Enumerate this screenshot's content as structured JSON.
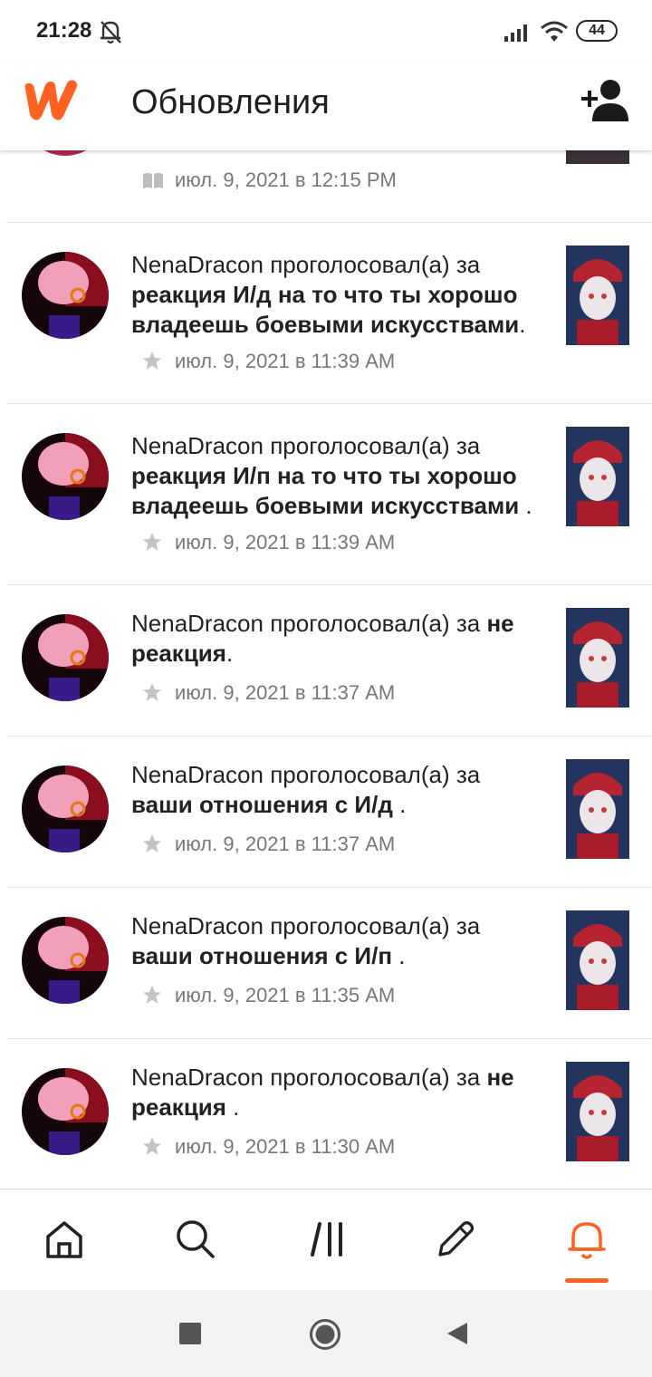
{
  "status_bar": {
    "time": "21:28",
    "battery": "44"
  },
  "header": {
    "title": "Обновления",
    "logo_icon": "wattpad-logo",
    "action_icon": "add-user-icon"
  },
  "partial_top_item": {
    "meta": "июл. 9, 2021 в 12:15 PM"
  },
  "notifications": [
    {
      "user": "NenaDracon",
      "action": " проголосовал(а) за ",
      "story": "реакция И/д на то что ты хорошо владеешь боевыми искусствами",
      "tail": ".",
      "meta": "июл. 9, 2021 в 11:39 AM"
    },
    {
      "user": "NenaDracon",
      "action": " проголосовал(а) за ",
      "story": "реакция И/п на то что ты хорошо владеешь боевыми искусствами",
      "tail": " .",
      "meta": "июл. 9, 2021 в 11:39 AM"
    },
    {
      "user": "NenaDracon",
      "action": " проголосовал(а) за ",
      "story": "не реакция",
      "tail": ".",
      "meta": "июл. 9, 2021 в 11:37 AM"
    },
    {
      "user": "NenaDracon",
      "action": " проголосовал(а) за ",
      "story": "ваши отношения с И/д",
      "tail": " .",
      "meta": "июл. 9, 2021 в 11:37 AM"
    },
    {
      "user": "NenaDracon",
      "action": " проголосовал(а) за ",
      "story": "ваши отношения с И/п",
      "tail": " .",
      "meta": "июл. 9, 2021 в 11:35 AM"
    },
    {
      "user": "NenaDracon",
      "action": " проголосовал(а) за ",
      "story": "не реакция",
      "tail": " .",
      "meta": "июл. 9, 2021 в 11:30 AM"
    }
  ],
  "bottom_nav": {
    "items": [
      "home-icon",
      "search-icon",
      "library-icon",
      "write-icon",
      "notifications-icon"
    ],
    "active": "notifications-icon",
    "accent_color": "#ff6122"
  },
  "colors": {
    "accent": "#ff6122",
    "text": "#222222",
    "meta": "#777777"
  }
}
